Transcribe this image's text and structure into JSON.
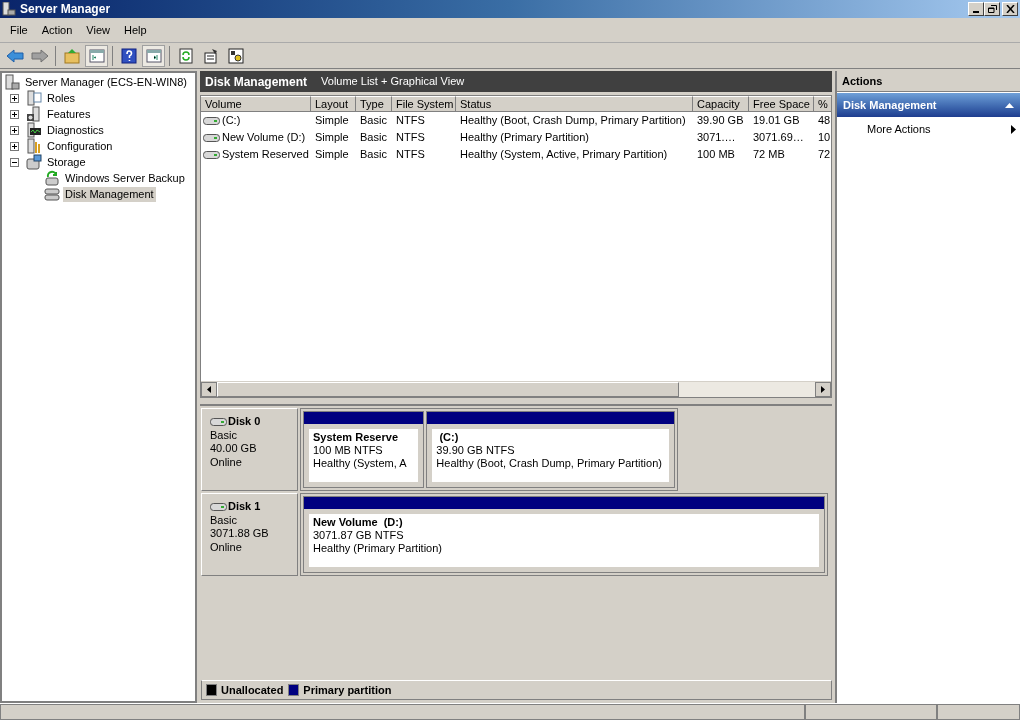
{
  "window": {
    "title": "Server Manager"
  },
  "menu": [
    "File",
    "Action",
    "View",
    "Help"
  ],
  "toolbar": [
    {
      "kind": "back",
      "pressed": false
    },
    {
      "kind": "forward",
      "pressed": false
    },
    {
      "kind": "sep"
    },
    {
      "kind": "up",
      "pressed": false
    },
    {
      "kind": "tree",
      "pressed": true
    },
    {
      "kind": "sep"
    },
    {
      "kind": "help",
      "pressed": false
    },
    {
      "kind": "pane",
      "pressed": true
    },
    {
      "kind": "sep"
    },
    {
      "kind": "refresh",
      "pressed": false
    },
    {
      "kind": "properties",
      "pressed": false
    },
    {
      "kind": "settings",
      "pressed": false
    }
  ],
  "tree": {
    "label": "Server Manager (ECS-EN-WIN8)",
    "selected": false,
    "children": [
      {
        "label": "Roles",
        "kind": "roles",
        "expanded": false,
        "selected": false
      },
      {
        "label": "Features",
        "kind": "features",
        "expanded": false,
        "selected": false
      },
      {
        "label": "Diagnostics",
        "kind": "diagnostics",
        "expanded": false,
        "selected": false
      },
      {
        "label": "Configuration",
        "kind": "configuration",
        "expanded": false,
        "selected": false
      },
      {
        "label": "Storage",
        "kind": "storage",
        "expanded": true,
        "selected": false,
        "children": [
          {
            "label": "Windows Server Backup",
            "kind": "backup",
            "selected": false
          },
          {
            "label": "Disk Management",
            "kind": "disk",
            "selected": true
          }
        ]
      }
    ]
  },
  "center": {
    "title": "Disk Management",
    "subtitle": "Volume List + Graphical View"
  },
  "table": {
    "columns": [
      "Volume",
      "Layout",
      "Type",
      "File System",
      "Status",
      "Capacity",
      "Free Space",
      "%"
    ],
    "rows": [
      [
        "(C:)",
        "Simple",
        "Basic",
        "NTFS",
        "Healthy (Boot, Crash Dump, Primary Partition)",
        "39.90 GB",
        "19.01 GB",
        "48"
      ],
      [
        "New Volume (D:)",
        "Simple",
        "Basic",
        "NTFS",
        "Healthy (Primary Partition)",
        "3071.…",
        "3071.69…",
        "10"
      ],
      [
        "System Reserved",
        "Simple",
        "Basic",
        "NTFS",
        "Healthy (System, Active, Primary Partition)",
        "100 MB",
        "72 MB",
        "72"
      ]
    ]
  },
  "disks": [
    {
      "name": "Disk 0",
      "type": "Basic",
      "size": "40.00 GB",
      "status": "Online",
      "partitions": [
        {
          "name": "System Reserve",
          "size": "100 MB NTFS",
          "status": "Healthy (System, A",
          "color": "#000080"
        },
        {
          "name": " (C:)",
          "size": "39.90 GB NTFS",
          "status": "Healthy (Boot, Crash Dump, Primary Partition)",
          "color": "#000080"
        }
      ]
    },
    {
      "name": "Disk 1",
      "type": "Basic",
      "size": "3071.88 GB",
      "status": "Online",
      "partitions": [
        {
          "name": "New Volume  (D:)",
          "size": "3071.87 GB NTFS",
          "status": "Healthy (Primary Partition)",
          "color": "#000080"
        }
      ]
    }
  ],
  "legend": [
    {
      "label": "Unallocated",
      "color": "#000000"
    },
    {
      "label": "Primary partition",
      "color": "#000080"
    }
  ],
  "actions": {
    "title": "Actions",
    "sections": [
      {
        "title": "Disk Management",
        "expanded": true,
        "items": [
          {
            "label": "More Actions",
            "submenu": true
          }
        ]
      }
    ]
  }
}
